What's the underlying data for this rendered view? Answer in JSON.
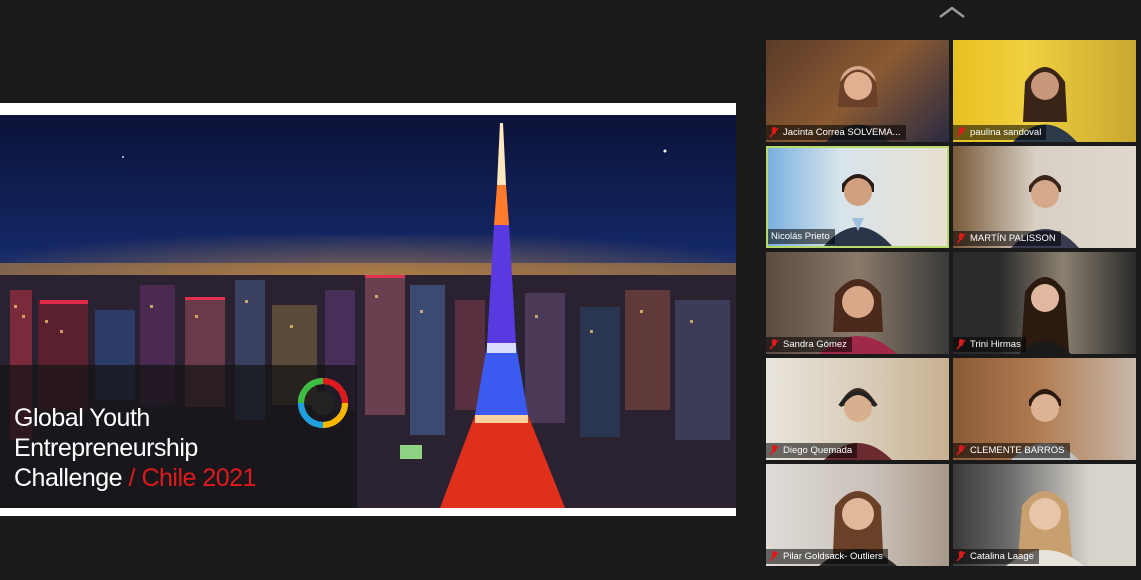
{
  "window": {
    "collapse_icon": "chevron-up-icon"
  },
  "share": {
    "slide": {
      "title_line1": "Global Youth",
      "title_line2": "Entrepreneurship",
      "title_line3": "Challenge",
      "separator": "/",
      "country": "Chile 2021",
      "accent_color": "#e0191c"
    }
  },
  "gallery": {
    "tiles": [
      {
        "name": "Jacinta Correa SOLVEMA...",
        "muted": true,
        "active": false
      },
      {
        "name": "paulina sandoval",
        "muted": true,
        "active": false
      },
      {
        "name": "Nicolás Prieto",
        "muted": false,
        "active": true
      },
      {
        "name": "MARTÍN PALISSON",
        "muted": true,
        "active": false
      },
      {
        "name": "Sandra Gómez",
        "muted": true,
        "active": false
      },
      {
        "name": "Trini Hirmas",
        "muted": true,
        "active": false
      },
      {
        "name": "Diego Quemada",
        "muted": true,
        "active": false
      },
      {
        "name": "CLEMENTE BARROS",
        "muted": true,
        "active": false
      },
      {
        "name": "Pilar Goldsack- Outliers",
        "muted": true,
        "active": false
      },
      {
        "name": "Catalina Laage",
        "muted": true,
        "active": false
      }
    ],
    "active_border_color": "#b7d96a",
    "muted_icon": "muted-mic-icon"
  }
}
